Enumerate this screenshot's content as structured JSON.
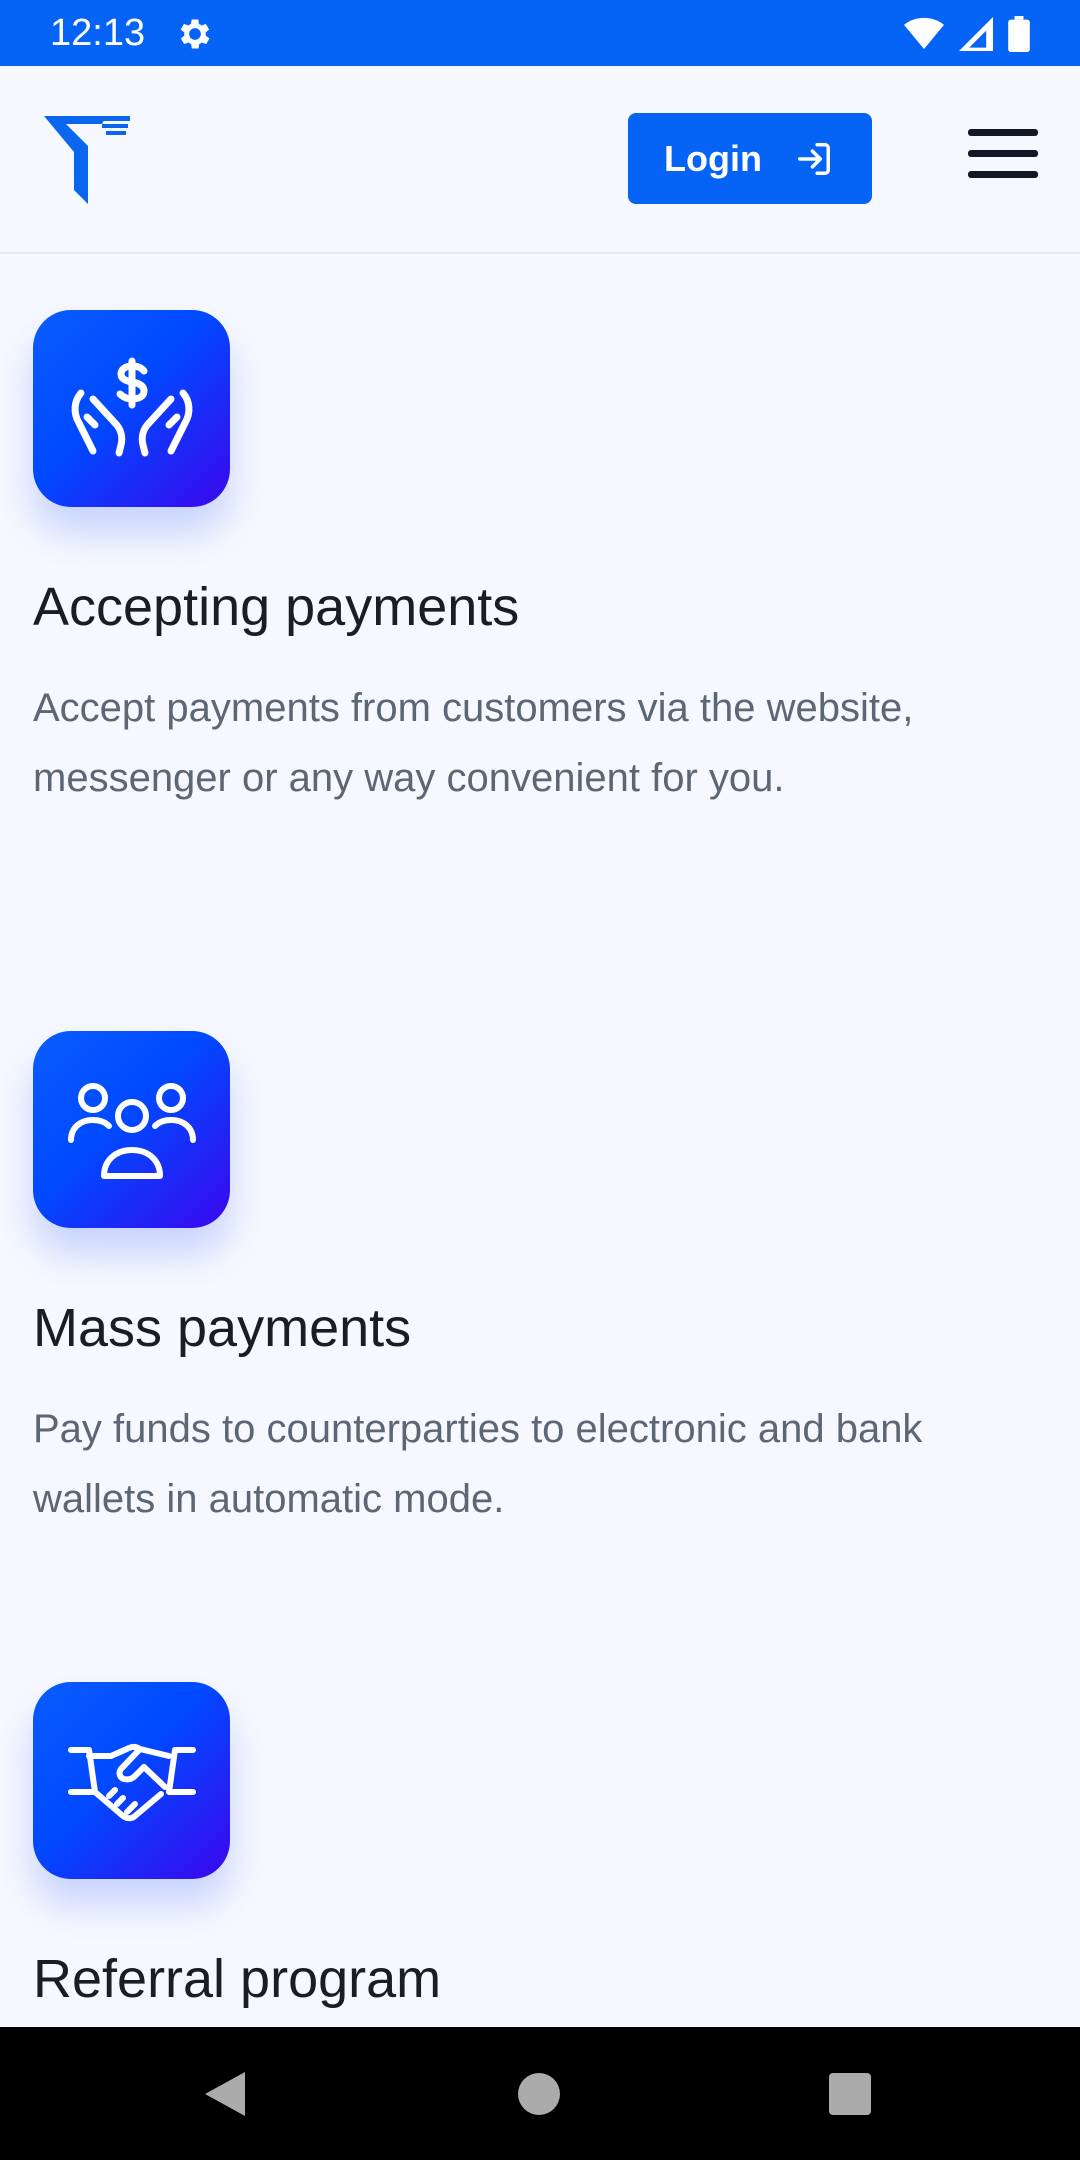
{
  "status_bar": {
    "time": "12:13",
    "settings_icon": "gear-icon",
    "wifi_icon": "wifi-icon",
    "signal_icon": "signal-icon",
    "battery_icon": "battery-icon"
  },
  "header": {
    "logo_icon": "t-logo-icon",
    "login_label": "Login",
    "login_icon": "login-arrow-icon",
    "menu_icon": "hamburger-menu-icon"
  },
  "features": [
    {
      "icon": "hands-dollar-icon",
      "title": "Accepting payments",
      "description": "Accept payments from customers via the website, messenger or any way convenient for you."
    },
    {
      "icon": "users-group-icon",
      "title": "Mass payments",
      "description": "Pay funds to counterparties to electronic and bank wallets in automatic mode."
    },
    {
      "icon": "handshake-icon",
      "title": "Referral program",
      "description": ""
    }
  ],
  "colors": {
    "primary": "#0563f5",
    "icon_gradient_end": "#3c06ee",
    "background": "#f5f8fe",
    "title_text": "#1a1d24",
    "body_text": "#5d6675"
  },
  "nav_bar": {
    "back_icon": "back-triangle-icon",
    "home_icon": "home-circle-icon",
    "recents_icon": "recents-square-icon"
  }
}
